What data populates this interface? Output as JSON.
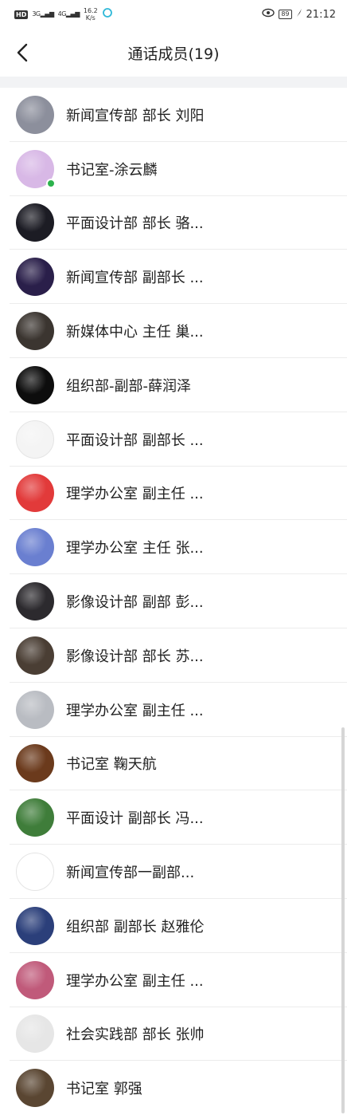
{
  "status_bar": {
    "network_badge": "HD",
    "signal1": "3G",
    "signal2": "4G",
    "speed_value": "16.2",
    "speed_unit": "K/s",
    "battery": "89",
    "time": "21:12"
  },
  "header": {
    "title": "通话成员(19)",
    "back_icon": "chevron-left-icon"
  },
  "members": [
    {
      "name": "新闻宣传部 部长 刘阳",
      "avatar_color": "#8c8f9c",
      "online": false
    },
    {
      "name": "书记室-涂云麟",
      "avatar_color": "#d8b8e6",
      "online": true
    },
    {
      "name": "平面设计部 部长 骆...",
      "avatar_color": "#1c1c24",
      "online": false
    },
    {
      "name": "新闻宣传部 副部长 ...",
      "avatar_color": "#2a1f4a",
      "online": false
    },
    {
      "name": "新媒体中心 主任 巢...",
      "avatar_color": "#3b3530",
      "online": false
    },
    {
      "name": "组织部-副部-薛润泽",
      "avatar_color": "#0d0d0d",
      "online": false
    },
    {
      "name": "平面设计部 副部长 ...",
      "avatar_color": "#f4f4f4",
      "online": false
    },
    {
      "name": "理学办公室 副主任 ...",
      "avatar_color": "#e23a3a",
      "online": false
    },
    {
      "name": "理学办公室 主任 张...",
      "avatar_color": "#6a7fd0",
      "online": false
    },
    {
      "name": "影像设计部 副部 彭...",
      "avatar_color": "#2c2a2e",
      "online": false
    },
    {
      "name": "影像设计部 部长 苏...",
      "avatar_color": "#4a3e34",
      "online": false
    },
    {
      "name": "理学办公室 副主任 ...",
      "avatar_color": "#b9bcc2",
      "online": false
    },
    {
      "name": "书记室 鞠天航",
      "avatar_color": "#6b3a1c",
      "online": false
    },
    {
      "name": "平面设计 副部长 冯...",
      "avatar_color": "#3f7d3a",
      "online": false
    },
    {
      "name": "新闻宣传部一副部...",
      "avatar_color": "#ffffff",
      "online": false
    },
    {
      "name": "组织部 副部长 赵雅伦",
      "avatar_color": "#2b3f7a",
      "online": false
    },
    {
      "name": "理学办公室 副主任 ...",
      "avatar_color": "#c05a7a",
      "online": false
    },
    {
      "name": "社会实践部 部长 张帅",
      "avatar_color": "#e6e6e6",
      "online": false
    },
    {
      "name": "书记室 郭强",
      "avatar_color": "#5a4632",
      "online": false
    }
  ]
}
